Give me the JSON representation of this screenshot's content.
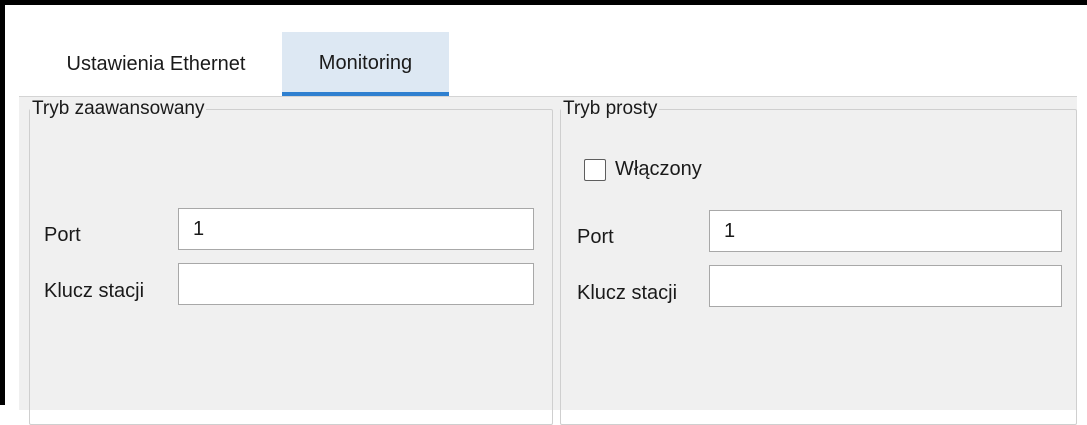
{
  "tabs": [
    {
      "label": "Ustawienia Ethernet",
      "active": false
    },
    {
      "label": "Monitoring",
      "active": true
    }
  ],
  "advanced": {
    "legend": "Tryb zaawansowany",
    "port_label": "Port",
    "port_value": "1",
    "station_key_label": "Klucz stacji",
    "station_key_value": ""
  },
  "simple": {
    "legend": "Tryb prosty",
    "enabled_label": "Włączony",
    "enabled_checked": false,
    "port_label": "Port",
    "port_value": "1",
    "station_key_label": "Klucz stacji",
    "station_key_value": ""
  },
  "colors": {
    "tab_active_bg": "#dde8f3",
    "tab_active_underline": "#2f80d0",
    "panel_bg": "#f0f0f0"
  }
}
